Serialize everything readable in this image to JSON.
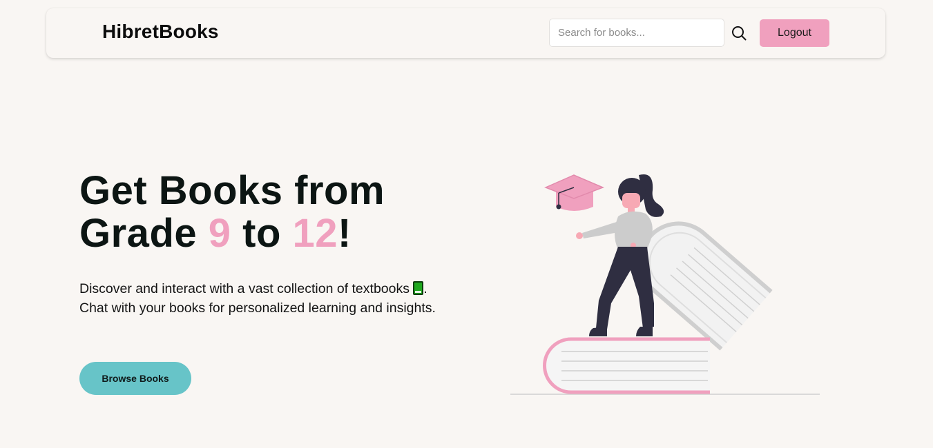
{
  "header": {
    "brand": "HibretBooks",
    "search": {
      "placeholder": "Search for books...",
      "value": "",
      "icon": "search-icon"
    },
    "logout_label": "Logout"
  },
  "hero": {
    "title_part1": "Get Books from",
    "title_part2": "Grade ",
    "grade_from": "9",
    "title_part3": " to ",
    "grade_to": "12",
    "title_part4": "!",
    "description_part1": "Discover and interact with a vast collection of textbooks",
    "description_icon": "green-book-icon",
    "description_part2": ". Chat with your books for personalized learning and insights.",
    "browse_label": "Browse Books",
    "illustration": "person-with-graduation-cap-on-books"
  },
  "colors": {
    "background": "#f9f6f3",
    "accent_pink": "#f0a0be",
    "accent_teal": "#67c4c8",
    "text_dark": "#0c1513"
  }
}
